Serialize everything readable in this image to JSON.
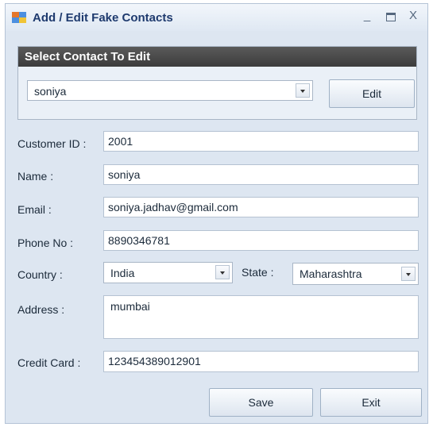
{
  "window": {
    "title": "Add / Edit Fake Contacts",
    "minimize_glyph": "_",
    "close_glyph": "X"
  },
  "select_group": {
    "header": "Select Contact To Edit",
    "selected_contact": "soniya",
    "edit_label": "Edit"
  },
  "form": {
    "customer_id_label": "Customer ID :",
    "customer_id": "2001",
    "name_label": "Name :",
    "name": "soniya",
    "email_label": "Email :",
    "email": "soniya.jadhav@gmail.com",
    "phone_label": "Phone No :",
    "phone": "8890346781",
    "country_label": "Country :",
    "country": "India",
    "state_label": "State :",
    "state": "Maharashtra",
    "address_label": "Address :",
    "address": "mumbai",
    "credit_card_label": "Credit Card :",
    "credit_card": "123454389012901"
  },
  "actions": {
    "save_label": "Save",
    "exit_label": "Exit"
  },
  "icons": [
    "app-icon",
    "minimize-icon",
    "maximize-icon",
    "close-icon",
    "dropdown-arrow-icon"
  ]
}
